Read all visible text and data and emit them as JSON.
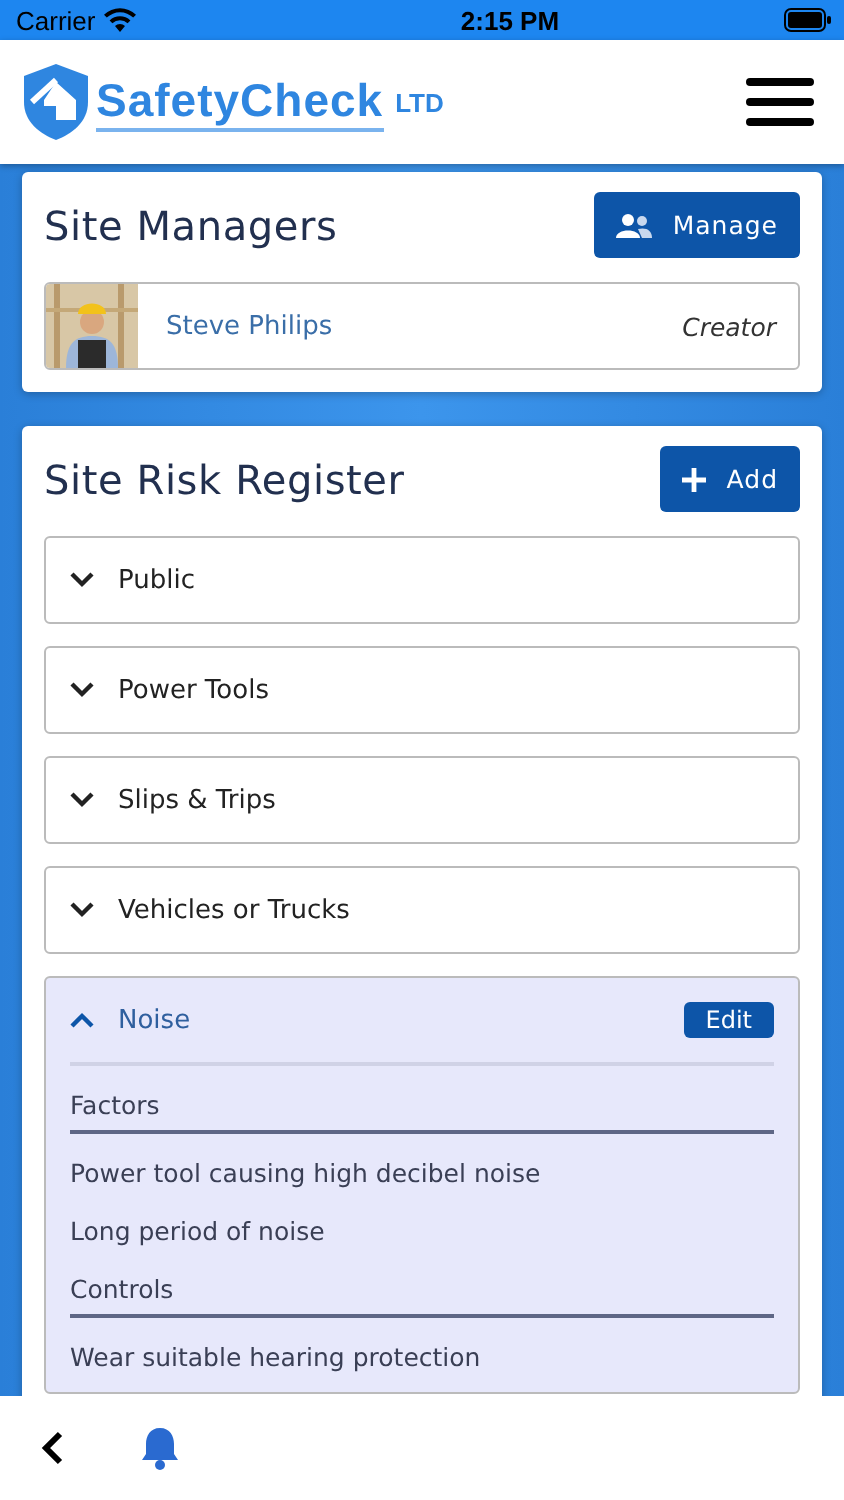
{
  "status_bar": {
    "carrier": "Carrier",
    "time": "2:15 PM"
  },
  "header": {
    "logo_text": "SafetyCheck",
    "logo_suffix": "LTD"
  },
  "site_managers": {
    "title": "Site Managers",
    "button": "Manage",
    "managers": [
      {
        "name": "Steve Philips",
        "role": "Creator"
      }
    ]
  },
  "risk_register": {
    "title": "Site Risk Register",
    "button": "Add",
    "categories": [
      {
        "label": "Public",
        "expanded": false
      },
      {
        "label": "Power Tools",
        "expanded": false
      },
      {
        "label": "Slips & Trips",
        "expanded": false
      },
      {
        "label": "Vehicles or Trucks",
        "expanded": false
      },
      {
        "label": "Noise",
        "expanded": true,
        "edit_button": "Edit",
        "sections": [
          {
            "heading": "Factors",
            "items": [
              "Power tool causing high decibel noise",
              "Long period of noise"
            ]
          },
          {
            "heading": "Controls",
            "items": [
              "Wear suitable hearing protection"
            ]
          }
        ]
      }
    ]
  }
}
